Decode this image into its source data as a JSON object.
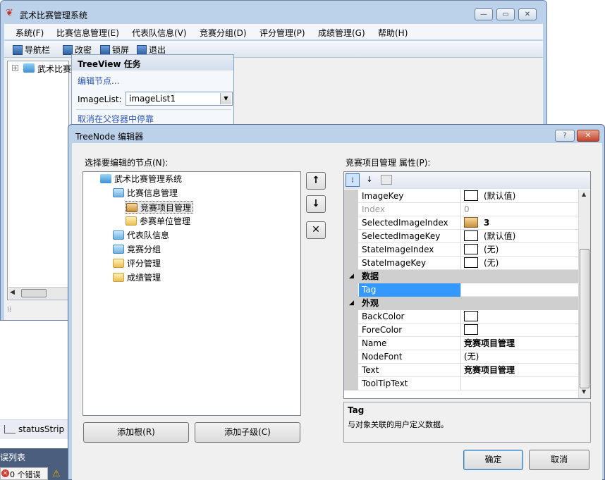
{
  "main_window": {
    "title": "武术比赛管理系统",
    "caption_buttons": {
      "minimize": "▭",
      "maximize": "▭",
      "close": "✕"
    },
    "menu": [
      "系统(F)",
      "比赛信息管理(E)",
      "代表队信息(V)",
      "竞赛分组(D)",
      "评分管理(P)",
      "成绩管理(G)",
      "帮助(H)"
    ],
    "toolbar": [
      "导航栏",
      "改密",
      "锁屏",
      "退出"
    ],
    "tree_root_label": "武术比赛"
  },
  "tasks_panel": {
    "title": "TreeView 任务",
    "edit_nodes_link": "编辑节点...",
    "imagelist_label": "ImageList:",
    "imagelist_value": "imageList1",
    "undock_link": "取消在父容器中停靠"
  },
  "status_strip_label": "statusStrip",
  "error_list": {
    "title": "误列表",
    "errors": "0 个错误"
  },
  "dialog": {
    "title": "TreeNode 编辑器",
    "help_button": "?",
    "close_button": "✕",
    "select_label": "选择要编辑的节点(N):",
    "nodes": [
      {
        "label": "武术比赛管理系统",
        "level": 0,
        "icon": "folder-open-blue-icon"
      },
      {
        "label": "比赛信息管理",
        "level": 1,
        "icon": "folder-blue-icon"
      },
      {
        "label": "竞赛项目管理",
        "level": 2,
        "icon": "box-icon",
        "selected": true
      },
      {
        "label": "参赛单位管理",
        "level": 2,
        "icon": "folder-yellow-icon"
      },
      {
        "label": "代表队信息",
        "level": 1,
        "icon": "folder-blue-icon"
      },
      {
        "label": "竞赛分组",
        "level": 1,
        "icon": "folder-blue-icon"
      },
      {
        "label": "评分管理",
        "level": 1,
        "icon": "folder-yellow-icon"
      },
      {
        "label": "成绩管理",
        "level": 1,
        "icon": "folder-yellow-icon"
      }
    ],
    "move_up": "↑",
    "move_down": "↓",
    "delete": "✕",
    "add_root": "添加根(R)",
    "add_child": "添加子级(C)",
    "properties_label": "竞赛项目管理 属性(P):",
    "properties": [
      {
        "type": "row",
        "name": "ImageKey",
        "value": "(默认值)",
        "swatch": true
      },
      {
        "type": "row",
        "name": "Index",
        "value": "0",
        "disabled": true
      },
      {
        "type": "row",
        "name": "SelectedImageIndex",
        "value": "3",
        "image": true,
        "bold": true
      },
      {
        "type": "row",
        "name": "SelectedImageKey",
        "value": "(默认值)",
        "swatch": true
      },
      {
        "type": "row",
        "name": "StateImageIndex",
        "value": "(无)",
        "swatch": true
      },
      {
        "type": "row",
        "name": "StateImageKey",
        "value": "(无)",
        "swatch": true
      },
      {
        "type": "cat",
        "name": "数据"
      },
      {
        "type": "row",
        "name": "Tag",
        "value": "",
        "selected": true
      },
      {
        "type": "cat",
        "name": "外观"
      },
      {
        "type": "row",
        "name": "BackColor",
        "value": "",
        "swatch": true
      },
      {
        "type": "row",
        "name": "ForeColor",
        "value": "",
        "swatch": true
      },
      {
        "type": "row",
        "name": "Name",
        "value": "竞赛项目管理",
        "bold": true
      },
      {
        "type": "row",
        "name": "NodeFont",
        "value": "(无)"
      },
      {
        "type": "row",
        "name": "Text",
        "value": "竞赛项目管理",
        "bold": true
      },
      {
        "type": "row",
        "name": "ToolTipText",
        "value": ""
      }
    ],
    "description_title": "Tag",
    "description_text": "与对象关联的用户定义数据。",
    "ok": "确定",
    "cancel": "取消"
  }
}
